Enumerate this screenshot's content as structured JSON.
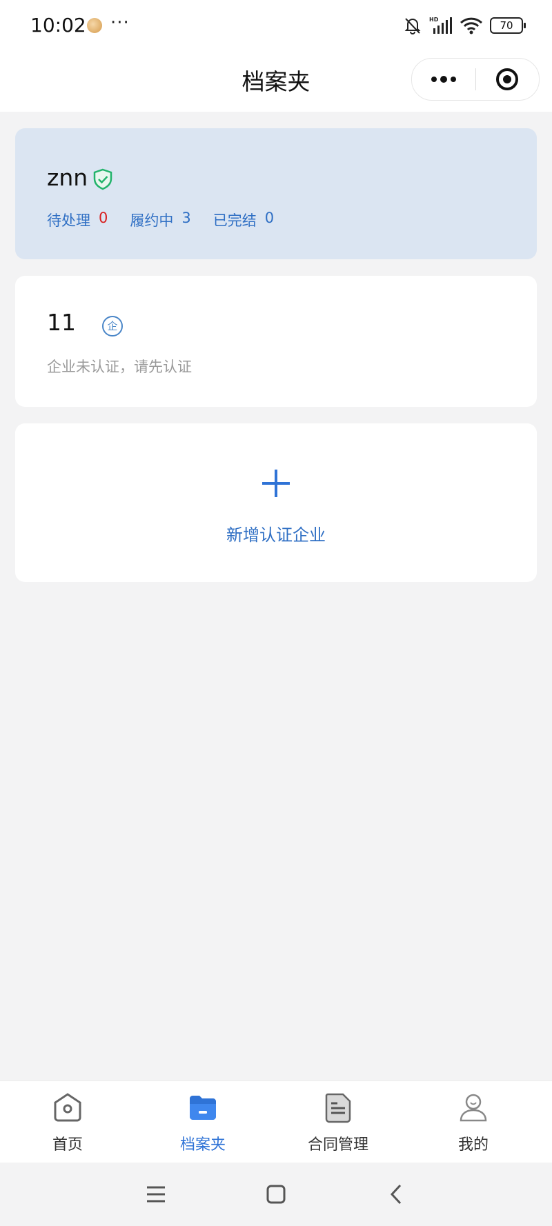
{
  "status_bar": {
    "time": "10:02",
    "more": "···",
    "signal_tag": "HD",
    "battery": "70",
    "icons": [
      "app-avatar-icon",
      "mute-bell-icon",
      "signal-icon",
      "wifi-icon",
      "battery-icon"
    ]
  },
  "nav": {
    "title": "档案夹",
    "capsule_icons": [
      "more-dots-icon",
      "close-target-icon"
    ]
  },
  "user_card": {
    "name": "znn",
    "verified_icon": "shield-check-icon",
    "stats": [
      {
        "label": "待处理",
        "value": "0"
      },
      {
        "label": "履约中",
        "value": "3"
      },
      {
        "label": "已完结",
        "value": "0"
      }
    ]
  },
  "company_card": {
    "name": "11",
    "badge": "企",
    "note": "企业未认证，请先认证"
  },
  "add_card": {
    "icon": "plus-icon",
    "label": "新增认证企业"
  },
  "tab_bar": {
    "tabs": [
      {
        "label": "首页",
        "icon": "home-icon",
        "active": false
      },
      {
        "label": "档案夹",
        "icon": "folder-icon",
        "active": true
      },
      {
        "label": "合同管理",
        "icon": "document-icon",
        "active": false
      },
      {
        "label": "我的",
        "icon": "user-icon",
        "active": false
      }
    ]
  },
  "system_nav": {
    "icons": [
      "menu-icon",
      "home-square-icon",
      "back-icon"
    ]
  },
  "colors": {
    "accent": "#2f73d6",
    "user_card_bg": "#dbe5f2",
    "alert_red": "#d81e1e",
    "verified_green": "#22b36b",
    "page_bg": "#f3f3f4"
  }
}
